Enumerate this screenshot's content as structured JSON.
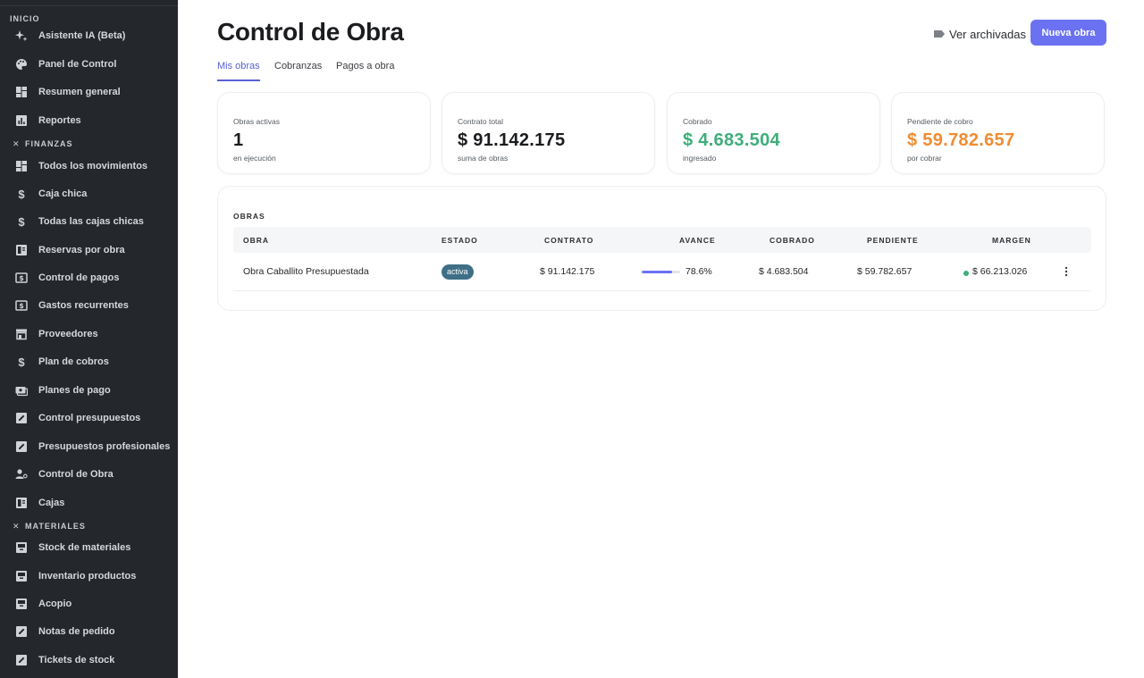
{
  "sidebar": {
    "sections": [
      {
        "label": "INICIO",
        "items": [
          {
            "label": "Asistente IA (Beta)",
            "icon": "sparkle-icon"
          },
          {
            "label": "Panel de Control",
            "icon": "palette-icon"
          },
          {
            "label": "Resumen general",
            "icon": "dashboard-icon"
          },
          {
            "label": "Reportes",
            "icon": "bar-chart-icon"
          }
        ]
      },
      {
        "label": "FINANZAS",
        "items": [
          {
            "label": "Todos los movimientos",
            "icon": "dashboard-icon"
          },
          {
            "label": "Caja chica",
            "icon": "dollar-icon"
          },
          {
            "label": "Todas las cajas chicas",
            "icon": "dollar-icon"
          },
          {
            "label": "Reservas por obra",
            "icon": "ledger-icon"
          },
          {
            "label": "Control de pagos",
            "icon": "cash-icon"
          },
          {
            "label": "Gastos recurrentes",
            "icon": "cash-icon"
          },
          {
            "label": "Proveedores",
            "icon": "store-icon"
          },
          {
            "label": "Plan de cobros",
            "icon": "dollar-icon"
          },
          {
            "label": "Planes de pago",
            "icon": "payments-icon"
          },
          {
            "label": "Control presupuestos",
            "icon": "edit-doc-icon"
          },
          {
            "label": "Presupuestos profesionales",
            "icon": "edit-doc-icon"
          },
          {
            "label": "Control de Obra",
            "icon": "person-gear-icon"
          },
          {
            "label": "Cajas",
            "icon": "ledger-icon"
          }
        ]
      },
      {
        "label": "MATERIALES",
        "items": [
          {
            "label": "Stock de materiales",
            "icon": "inventory-icon"
          },
          {
            "label": "Inventario productos",
            "icon": "inventory-icon"
          },
          {
            "label": "Acopio",
            "icon": "inventory-icon"
          },
          {
            "label": "Notas de pedido",
            "icon": "edit-doc-icon"
          },
          {
            "label": "Tickets de stock",
            "icon": "edit-doc-icon"
          }
        ]
      }
    ]
  },
  "header": {
    "title": "Control de Obra",
    "archived_label": "Ver archivadas",
    "new_label": "Nueva obra"
  },
  "tabs": [
    {
      "label": "Mis obras",
      "active": true
    },
    {
      "label": "Cobranzas",
      "active": false
    },
    {
      "label": "Pagos a obra",
      "active": false
    }
  ],
  "stats": [
    {
      "label": "Obras activas",
      "value": "1",
      "sub": "en ejecución"
    },
    {
      "label": "Contrato total",
      "value": "$ 91.142.175",
      "sub": "suma de obras"
    },
    {
      "label": "Cobrado",
      "value": "$ 4.683.504",
      "sub": "ingresado"
    },
    {
      "label": "Pendiente de cobro",
      "value": "$ 59.782.657",
      "sub": "por cobrar"
    }
  ],
  "table": {
    "title": "OBRAS",
    "columns": [
      "OBRA",
      "ESTADO",
      "CONTRATO",
      "AVANCE",
      "COBRADO",
      "PENDIENTE",
      "MARGEN"
    ],
    "rows": [
      {
        "obra": "Obra Caballito Presupuestada",
        "estado": "activa",
        "contrato": "$ 91.142.175",
        "avance": "78.6%",
        "avance_value": 78.6,
        "cobrado": "$ 4.683.504",
        "pendiente": "$ 59.782.657",
        "margen": "$ 66.213.026"
      }
    ]
  },
  "colors": {
    "accent": "#6b72f2",
    "positive": "#3fae7a",
    "warning": "#f08c32",
    "sidebar_bg": "#24272b",
    "badge_bg": "#3f6f86"
  }
}
